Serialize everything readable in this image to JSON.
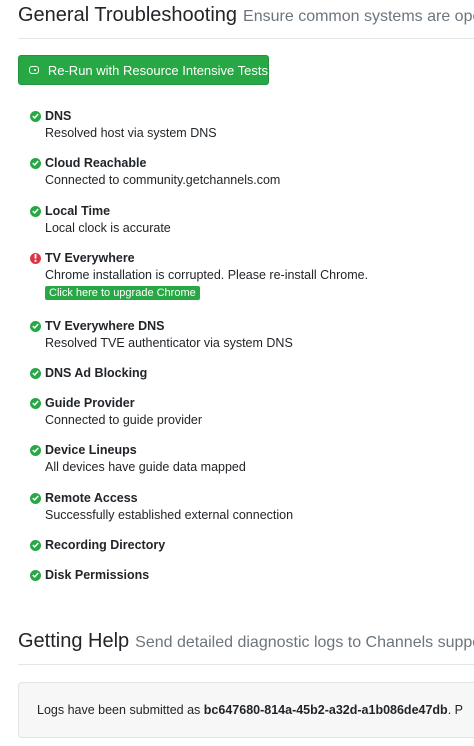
{
  "troubleshooting": {
    "title": "General Troubleshooting",
    "subtitle": "Ensure common systems are operat",
    "rerun_label": "Re-Run with Resource Intensive Tests",
    "checks": [
      {
        "name": "DNS",
        "status": "ok",
        "description": "Resolved host via system DNS"
      },
      {
        "name": "Cloud Reachable",
        "status": "ok",
        "description": "Connected to community.getchannels.com"
      },
      {
        "name": "Local Time",
        "status": "ok",
        "description": "Local clock is accurate"
      },
      {
        "name": "TV Everywhere",
        "status": "error",
        "description": "Chrome installation is corrupted. Please re-install Chrome.",
        "action_label": "Click here to upgrade Chrome"
      },
      {
        "name": "TV Everywhere DNS",
        "status": "ok",
        "description": "Resolved TVE authenticator via system DNS"
      },
      {
        "name": "DNS Ad Blocking",
        "status": "ok"
      },
      {
        "name": "Guide Provider",
        "status": "ok",
        "description": "Connected to guide provider"
      },
      {
        "name": "Device Lineups",
        "status": "ok",
        "description": "All devices have guide data mapped"
      },
      {
        "name": "Remote Access",
        "status": "ok",
        "description": "Successfully established external connection"
      },
      {
        "name": "Recording Directory",
        "status": "ok"
      },
      {
        "name": "Disk Permissions",
        "status": "ok"
      }
    ]
  },
  "help": {
    "title": "Getting Help",
    "subtitle": "Send detailed diagnostic logs to Channels support",
    "logs_prefix": "Logs have been submitted as",
    "logs_id": "bc647680-814a-45b2-a32d-a1b086de47db",
    "logs_suffix": ". P"
  },
  "colors": {
    "success": "#28a745",
    "danger": "#dc3545",
    "muted": "#6c757d"
  }
}
